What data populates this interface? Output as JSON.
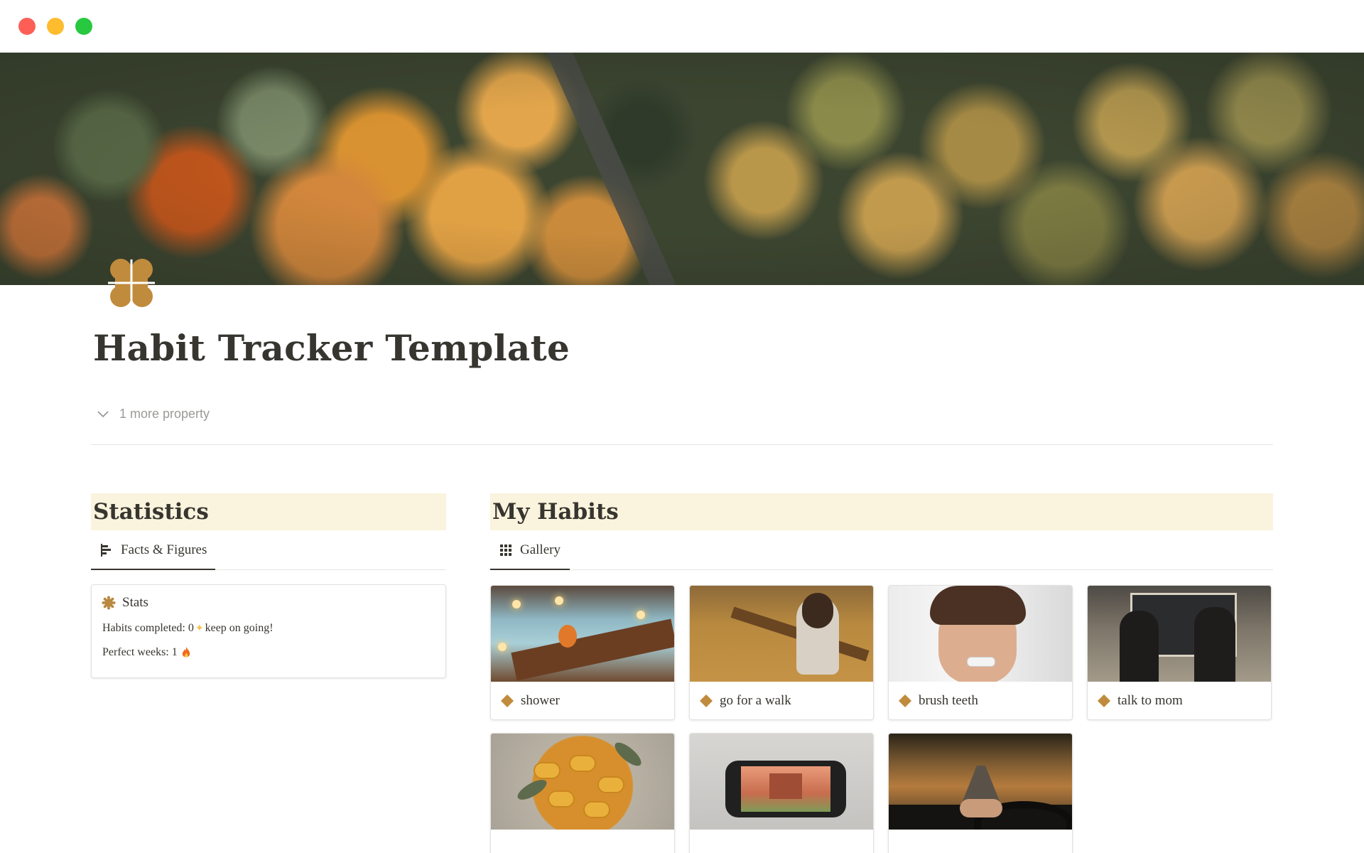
{
  "window": {
    "controls": [
      "close",
      "minimize",
      "zoom"
    ]
  },
  "cover": {
    "icon": "forest-cover-image"
  },
  "page": {
    "icon": "clover-icon",
    "title": "Habit Tracker Template",
    "properties_toggle": "1 more property"
  },
  "statistics": {
    "heading": "Statistics",
    "view_tab": "Facts & Figures",
    "card": {
      "title": "Stats",
      "habits_completed_label": "Habits completed: 0",
      "habits_completed_suffix": "keep on going!",
      "perfect_weeks_label": "Perfect weeks: 1"
    }
  },
  "habits": {
    "heading": "My Habits",
    "view_tab": "Gallery",
    "cards": [
      {
        "label": "shower"
      },
      {
        "label": "go for a walk"
      },
      {
        "label": "brush teeth"
      },
      {
        "label": "talk to mom"
      },
      {
        "label": ""
      },
      {
        "label": ""
      },
      {
        "label": ""
      }
    ]
  },
  "colors": {
    "section_header_bg": "#faf3dd",
    "accent_gold": "#c08b3c",
    "text": "#37352f",
    "muted": "#9b9a97"
  }
}
